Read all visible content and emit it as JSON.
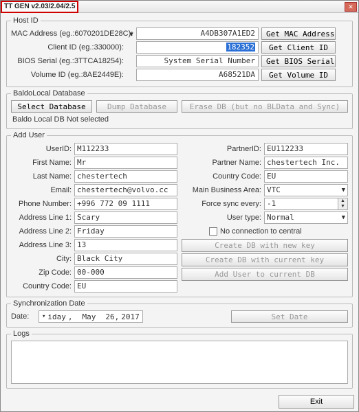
{
  "window": {
    "title_highlight": "TT GEN v2.03/2.04/2.5",
    "center_text": "",
    "close_icon": "✕"
  },
  "host": {
    "legend": "Host ID",
    "mac_label": "MAC Address (eg.:6070201DE28C):",
    "mac_value": "A4DB307A1ED2",
    "mac_btn": "Get MAC Address",
    "client_label": "Client ID (eg.:330000):",
    "client_value": "182352",
    "client_btn": "Get Client ID",
    "bios_label": "BIOS Serial (eg.:3TTCA18254):",
    "bios_value": "System Serial Number",
    "bios_btn": "Get BIOS Serial",
    "vol_label": "Volume ID (eg.:8AE2449E):",
    "vol_value": "A68521DA",
    "vol_btn": "Get Volume ID"
  },
  "baldo": {
    "legend": "BaldoLocal Database",
    "select_btn": "Select Database",
    "dump_btn": "Dump Database",
    "erase_btn": "Erase DB (but no BLData and Sync)",
    "status": "Baldo Local DB Not selected"
  },
  "adduser": {
    "legend": "Add User",
    "left": {
      "userid_l": "UserID:",
      "userid_v": "M112233",
      "first_l": "First Name:",
      "first_v": "Mr",
      "last_l": "Last Name:",
      "last_v": "chestertech",
      "email_l": "Email:",
      "email_v": "chestertech@volvo.cc",
      "phone_l": "Phone Number:",
      "phone_v": "+996 772 09 1111",
      "a1_l": "Address Line 1:",
      "a1_v": "Scary",
      "a2_l": "Address Line 2:",
      "a2_v": "Friday",
      "a3_l": "Address Line 3:",
      "a3_v": "13",
      "city_l": "City:",
      "city_v": "Black City",
      "zip_l": "Zip Code:",
      "zip_v": "00-000",
      "cc_l": "Country Code:",
      "cc_v": "EU"
    },
    "right": {
      "partnerid_l": "PartnerID:",
      "partnerid_v": "EU112233",
      "partnername_l": "Partner Name:",
      "partnername_v": "chestertech Inc.",
      "cc_l": "Country Code:",
      "cc_v": "EU",
      "mba_l": "Main Business Area:",
      "mba_v": "VTC",
      "force_l": "Force sync every:",
      "force_v": "-1",
      "usertype_l": "User type:",
      "usertype_v": "Normal",
      "noconn": "No connection to central",
      "btn_newkey": "Create DB with new key",
      "btn_curkey": "Create DB with current key",
      "btn_adduser": "Add User to current DB"
    }
  },
  "sync": {
    "legend": "Synchronization Date",
    "date_l": "Date:",
    "weekday": "iday",
    "sep": ",",
    "month": "May",
    "day": "26,",
    "year": "2017",
    "setbtn": "Set Date"
  },
  "logs": {
    "legend": "Logs"
  },
  "footer": {
    "exit": "Exit"
  }
}
